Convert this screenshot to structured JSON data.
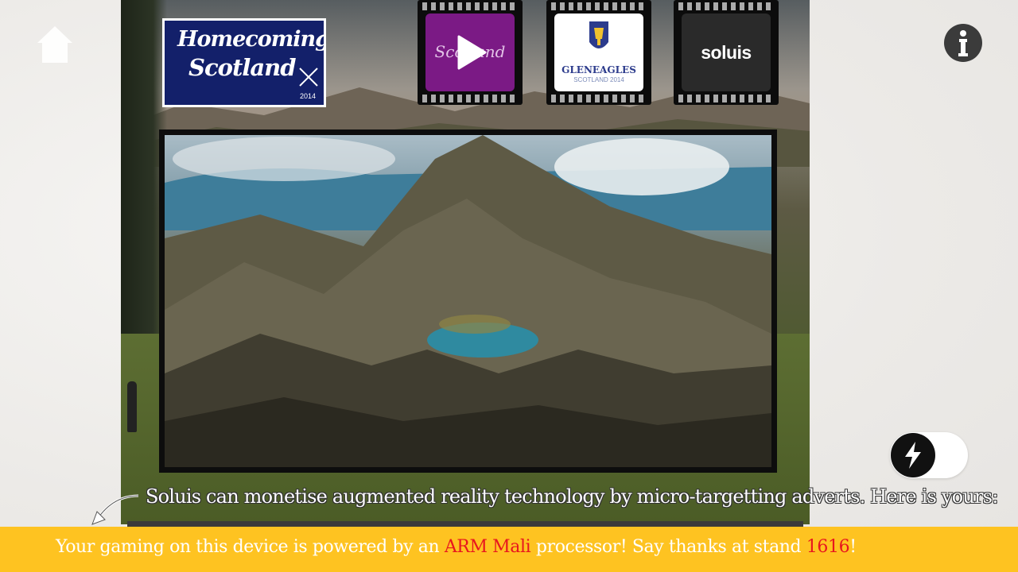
{
  "colors": {
    "bottom_bar": "#fec321",
    "highlight": "#e8161e",
    "scotland_purple": "#7b1a85",
    "homecoming_navy": "#13206a"
  },
  "header": {
    "home_icon": "home-icon",
    "info_icon": "info-icon"
  },
  "logos": {
    "homecoming": {
      "line1": "Homecoming",
      "line2": "Scotland",
      "year": "2014"
    },
    "scotland": {
      "text": "Scotland",
      "icon": "play-icon"
    },
    "gleneagles": {
      "badge": "RYDER CUP",
      "name": "GLENEAGLES",
      "sub": "SCOTLAND 2014"
    },
    "soluis": {
      "text": "soluis"
    }
  },
  "flash_toggle": {
    "icon": "lightning-icon",
    "state": "off"
  },
  "caption": {
    "text": "Soluis can monetise augmented reality technology by micro-targetting adverts. Here is yours:"
  },
  "bottom_bar": {
    "part1": "Your gaming on this device is powered by an ",
    "highlight1": "ARM Mali",
    "part2": " processor! Say thanks at stand ",
    "highlight2": "1616",
    "part3": "!"
  }
}
